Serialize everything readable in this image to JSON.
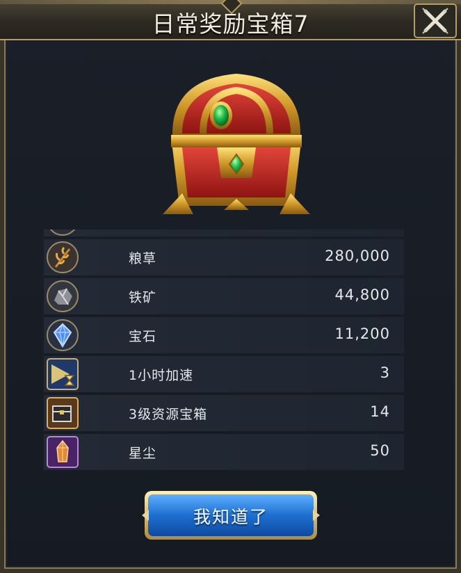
{
  "window": {
    "title": "日常奖励宝箱7"
  },
  "rewards": [
    {
      "name": "粮草",
      "qty": "280,000",
      "icon": "wheat-icon"
    },
    {
      "name": "铁矿",
      "qty": "44,800",
      "icon": "iron-ore-icon"
    },
    {
      "name": "宝石",
      "qty": "11,200",
      "icon": "gem-icon"
    },
    {
      "name": "1小时加速",
      "qty": "3",
      "icon": "speedup-hourglass-icon"
    },
    {
      "name": "3级资源宝箱",
      "qty": "14",
      "icon": "resource-chest-icon"
    },
    {
      "name": "星尘",
      "qty": "50",
      "icon": "stardust-crystal-icon"
    }
  ],
  "confirm_button": {
    "label": "我知道了"
  },
  "colors": {
    "accent_gold": "#b59e64",
    "button_blue": "#1d6fd0",
    "row_bg": "#232a36"
  }
}
